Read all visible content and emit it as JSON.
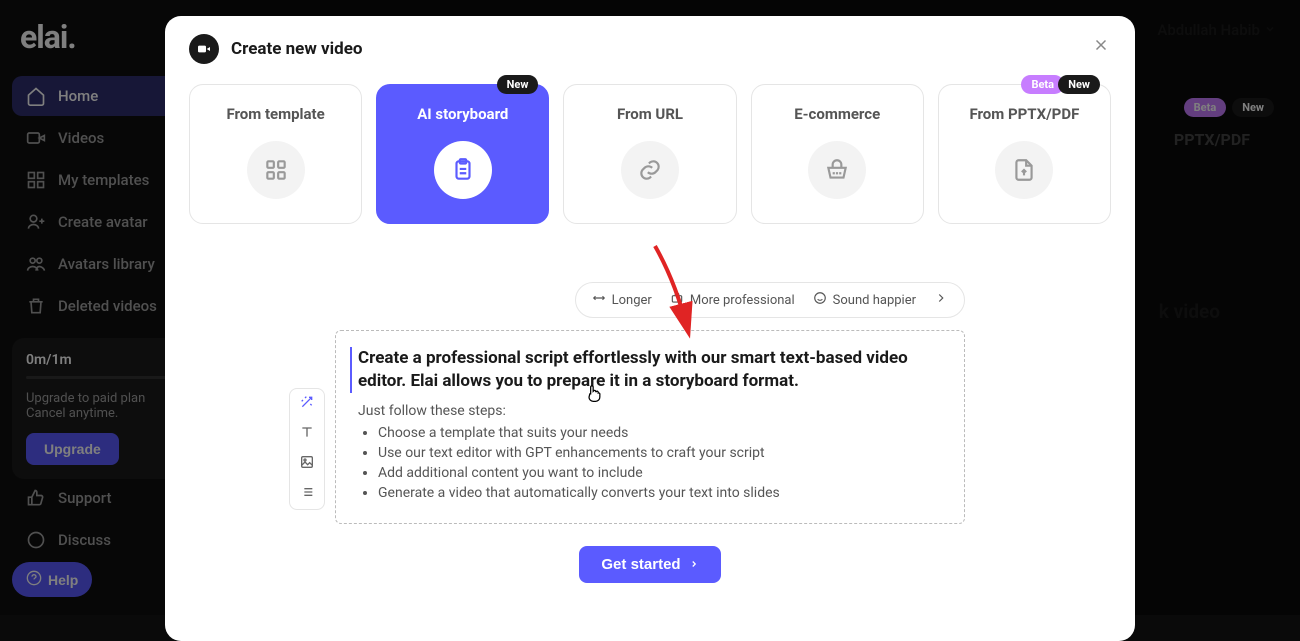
{
  "logo": "elai.",
  "user_name": "Abdullah Habib",
  "sidebar": {
    "items": [
      {
        "label": "Home"
      },
      {
        "label": "Videos"
      },
      {
        "label": "My templates"
      },
      {
        "label": "Create avatar"
      },
      {
        "label": "Avatars library"
      },
      {
        "label": "Deleted videos"
      }
    ],
    "support": "Support",
    "discuss": "Discuss",
    "help": "Help"
  },
  "usage": {
    "title": "0m/1m",
    "text1": "Upgrade to paid plan",
    "text2": "Cancel anytime.",
    "button": "Upgrade"
  },
  "bg_main": {
    "badge_beta": "Beta",
    "badge_new": "New",
    "pptx": "PPTX/PDF",
    "blank": "k video"
  },
  "modal": {
    "title": "Create new video",
    "options": [
      {
        "label": "From template",
        "badge": null
      },
      {
        "label": "AI storyboard",
        "badge": "New"
      },
      {
        "label": "From URL",
        "badge": null
      },
      {
        "label": "E-commerce",
        "badge": null
      },
      {
        "label": "From PPTX/PDF",
        "badge_beta": "Beta",
        "badge_new": "New"
      }
    ],
    "pills": {
      "longer": "Longer",
      "professional": "More professional",
      "happier": "Sound happier"
    },
    "script": {
      "heading": "Create a professional script effortlessly with our smart text-based video editor. Elai allows you to prepare it in a storyboard format.",
      "sub": "Just follow these steps:",
      "steps": [
        "Choose a template that suits your needs",
        "Use our text editor with GPT enhancements to craft your script",
        "Add additional content you want to include",
        "Generate a video that automatically converts your text into slides"
      ]
    },
    "cta": "Get started"
  }
}
